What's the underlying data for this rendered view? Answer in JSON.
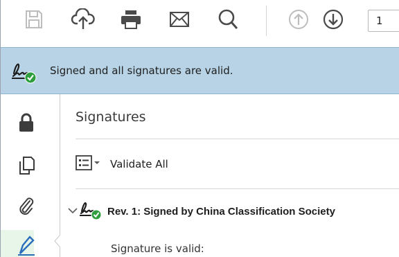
{
  "toolbar": {
    "tools": [
      {
        "name": "save-icon",
        "interactable": true
      },
      {
        "name": "cloud-upload-icon",
        "interactable": true
      },
      {
        "name": "print-icon",
        "interactable": true
      },
      {
        "name": "mail-icon",
        "interactable": true
      },
      {
        "name": "search-icon",
        "interactable": true
      },
      {
        "name": "previous-page-icon",
        "interactable": true
      },
      {
        "name": "next-page-icon",
        "interactable": true
      }
    ],
    "page_number": "1"
  },
  "banner": {
    "icon": "signature-valid-icon",
    "text": "Signed and all signatures are valid."
  },
  "nav_rail": {
    "items": [
      {
        "name": "lock-icon"
      },
      {
        "name": "pages-icon"
      },
      {
        "name": "attachment-icon"
      },
      {
        "name": "signature-pen-icon",
        "active": true
      }
    ]
  },
  "panel": {
    "title": "Signatures",
    "validate_all_label": "Validate All",
    "signature": {
      "title": "Rev. 1: Signed by China Classification Society",
      "detail": "Signature is valid:"
    }
  },
  "colors": {
    "banner_bg": "#b7d3e5",
    "valid_green": "#2e9e3e",
    "icon_gray": "#4a4a4a"
  }
}
